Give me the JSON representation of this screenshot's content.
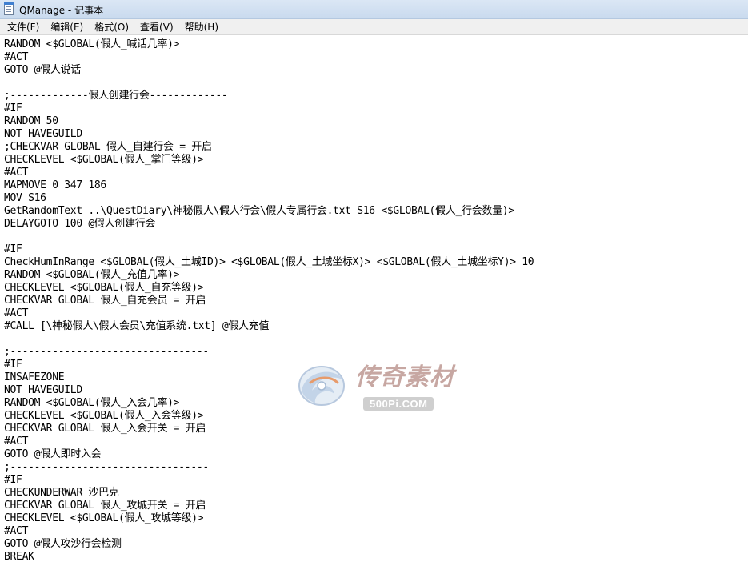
{
  "window": {
    "title": "QManage - 记事本",
    "app_icon": "notepad-icon"
  },
  "menubar": {
    "items": [
      {
        "label": "文件(F)"
      },
      {
        "label": "编辑(E)"
      },
      {
        "label": "格式(O)"
      },
      {
        "label": "查看(V)"
      },
      {
        "label": "帮助(H)"
      }
    ]
  },
  "editor": {
    "lines": [
      "RANDOM <$GLOBAL(假人_喊话几率)>",
      "#ACT",
      "GOTO @假人说话",
      "",
      ";-------------假人创建行会-------------",
      "#IF",
      "RANDOM 50",
      "NOT HAVEGUILD",
      ";CHECKVAR GLOBAL 假人_自建行会 = 开启",
      "CHECKLEVEL <$GLOBAL(假人_掌门等级)>",
      "#ACT",
      "MAPMOVE 0 347 186",
      "MOV S16",
      "GetRandomText ..\\QuestDiary\\神秘假人\\假人行会\\假人专属行会.txt S16 <$GLOBAL(假人_行会数量)>",
      "DELAYGOTO 100 @假人创建行会",
      "",
      "#IF",
      "CheckHumInRange <$GLOBAL(假人_土城ID)> <$GLOBAL(假人_土城坐标X)> <$GLOBAL(假人_土城坐标Y)> 10",
      "RANDOM <$GLOBAL(假人_充值几率)>",
      "CHECKLEVEL <$GLOBAL(假人_自充等级)>",
      "CHECKVAR GLOBAL 假人_自充会员 = 开启",
      "#ACT",
      "#CALL [\\神秘假人\\假人会员\\充值系统.txt] @假人充值",
      "",
      ";---------------------------------",
      "#IF",
      "INSAFEZONE",
      "NOT HAVEGUILD",
      "RANDOM <$GLOBAL(假人_入会几率)>",
      "CHECKLEVEL <$GLOBAL(假人_入会等级)>",
      "CHECKVAR GLOBAL 假人_入会开关 = 开启",
      "#ACT",
      "GOTO @假人即时入会",
      ";---------------------------------",
      "#IF",
      "CHECKUNDERWAR 沙巴克",
      "CHECKVAR GLOBAL 假人_攻城开关 = 开启",
      "CHECKLEVEL <$GLOBAL(假人_攻城等级)>",
      "#ACT",
      "GOTO @假人攻沙行会检测",
      "BREAK"
    ]
  },
  "watermark": {
    "brand": "传奇素材",
    "domain": "500Pi.COM",
    "icon": "swirl-logo-icon"
  }
}
